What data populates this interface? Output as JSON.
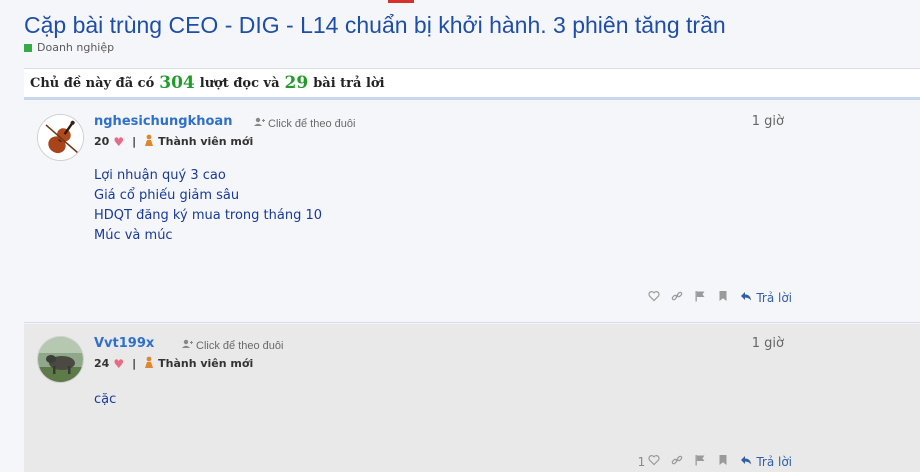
{
  "topic": {
    "title": "Cặp bài trùng CEO - DIG - L14 chuẩn bị khởi hành. 3 phiên tăng trần",
    "category": "Doanh nghiệp",
    "category_color": "#3aa845"
  },
  "stats": {
    "prefix": "Chủ đề này đã có",
    "views": "304",
    "middle": "lượt đọc và",
    "replies": "29",
    "suffix": "bài trả lời"
  },
  "posts": [
    {
      "username": "nghesichungkhoan",
      "follow_label": "Click để theo đuôi",
      "score": "20",
      "rank": "Thành viên mới",
      "time": "1 giờ",
      "lines": [
        "Lợi nhuận quý 3 cao",
        "Giá cổ phiếu giảm sâu",
        "HDQT đăng ký mua trong tháng 10",
        "Múc và múc"
      ],
      "reply_label": "Trả lời",
      "avatar_icon": "violin-avatar"
    },
    {
      "username": "Vvt199x",
      "follow_label": "Click để theo đuôi",
      "score": "24",
      "rank": "Thành viên mới",
      "time": "1 giờ",
      "lines": [
        "cặc"
      ],
      "like_count": "1",
      "reply_label": "Trả lời",
      "avatar_icon": "animal-photo-avatar"
    }
  ],
  "colors": {
    "title": "#1f4ea8",
    "username": "#2f70c9",
    "stat_number": "#239b2c",
    "post_text": "#1a3a9a"
  }
}
